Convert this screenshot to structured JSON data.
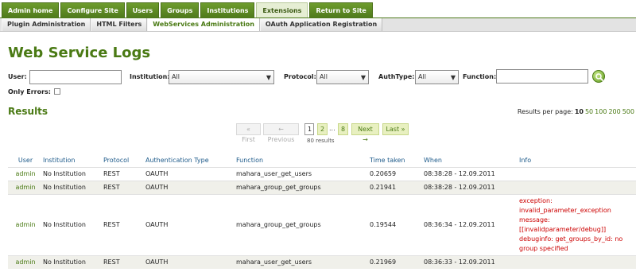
{
  "topnav": {
    "tabs": [
      {
        "label": "Admin home",
        "active": false
      },
      {
        "label": "Configure Site",
        "active": false
      },
      {
        "label": "Users",
        "active": false
      },
      {
        "label": "Groups",
        "active": false
      },
      {
        "label": "Institutions",
        "active": false
      },
      {
        "label": "Extensions",
        "active": true
      },
      {
        "label": "Return to Site",
        "active": false
      }
    ]
  },
  "subnav": {
    "tabs": [
      {
        "label": "Plugin Administration",
        "active": false
      },
      {
        "label": "HTML Filters",
        "active": false
      },
      {
        "label": "WebServices Administration",
        "active": true
      },
      {
        "label": "OAuth Application Registration",
        "active": false
      }
    ]
  },
  "page": {
    "title": "Web Service Logs"
  },
  "filters": {
    "user_label": "User:",
    "user_value": "",
    "institution_label": "Institution:",
    "institution_value": "All",
    "protocol_label": "Protocol:",
    "protocol_value": "All",
    "authtype_label": "AuthType:",
    "authtype_value": "All",
    "function_label": "Function:",
    "function_value": "",
    "only_errors_label": "Only Errors:",
    "only_errors_checked": false
  },
  "results": {
    "heading": "Results",
    "per_page_label": "Results per page:",
    "per_page_current": "10",
    "per_page_options": [
      "50",
      "100",
      "200",
      "500"
    ],
    "count_text": "80 results"
  },
  "pagination": {
    "first": "« First",
    "previous": "← Previous",
    "pages": [
      "1",
      "2",
      "8"
    ],
    "ellipsis": "...",
    "next": "Next →",
    "last": "Last »",
    "current_page": "1"
  },
  "table": {
    "headers": [
      "User",
      "Institution",
      "Protocol",
      "Authentication Type",
      "Function",
      "Time taken",
      "When",
      "Info"
    ],
    "rows": [
      {
        "user": "admin",
        "institution": "No Institution",
        "protocol": "REST",
        "auth": "OAUTH",
        "function": "mahara_user_get_users",
        "time": "0.20659",
        "when": "08:38:28 - 12.09.2011",
        "info": []
      },
      {
        "user": "admin",
        "institution": "No Institution",
        "protocol": "REST",
        "auth": "OAUTH",
        "function": "mahara_group_get_groups",
        "time": "0.21941",
        "when": "08:38:28 - 12.09.2011",
        "info": []
      },
      {
        "user": "admin",
        "institution": "No Institution",
        "protocol": "REST",
        "auth": "OAUTH",
        "function": "mahara_group_get_groups",
        "time": "0.19544",
        "when": "08:36:34 - 12.09.2011",
        "info": [
          "exception:",
          "invalid_parameter_exception",
          "message:",
          "[[invalidparameter/debug]]",
          "debuginfo: get_groups_by_id: no",
          "group specified"
        ]
      },
      {
        "user": "admin",
        "institution": "No Institution",
        "protocol": "REST",
        "auth": "OAUTH",
        "function": "mahara_user_get_users",
        "time": "0.21969",
        "when": "08:36:33 - 12.09.2011",
        "info": []
      }
    ]
  }
}
